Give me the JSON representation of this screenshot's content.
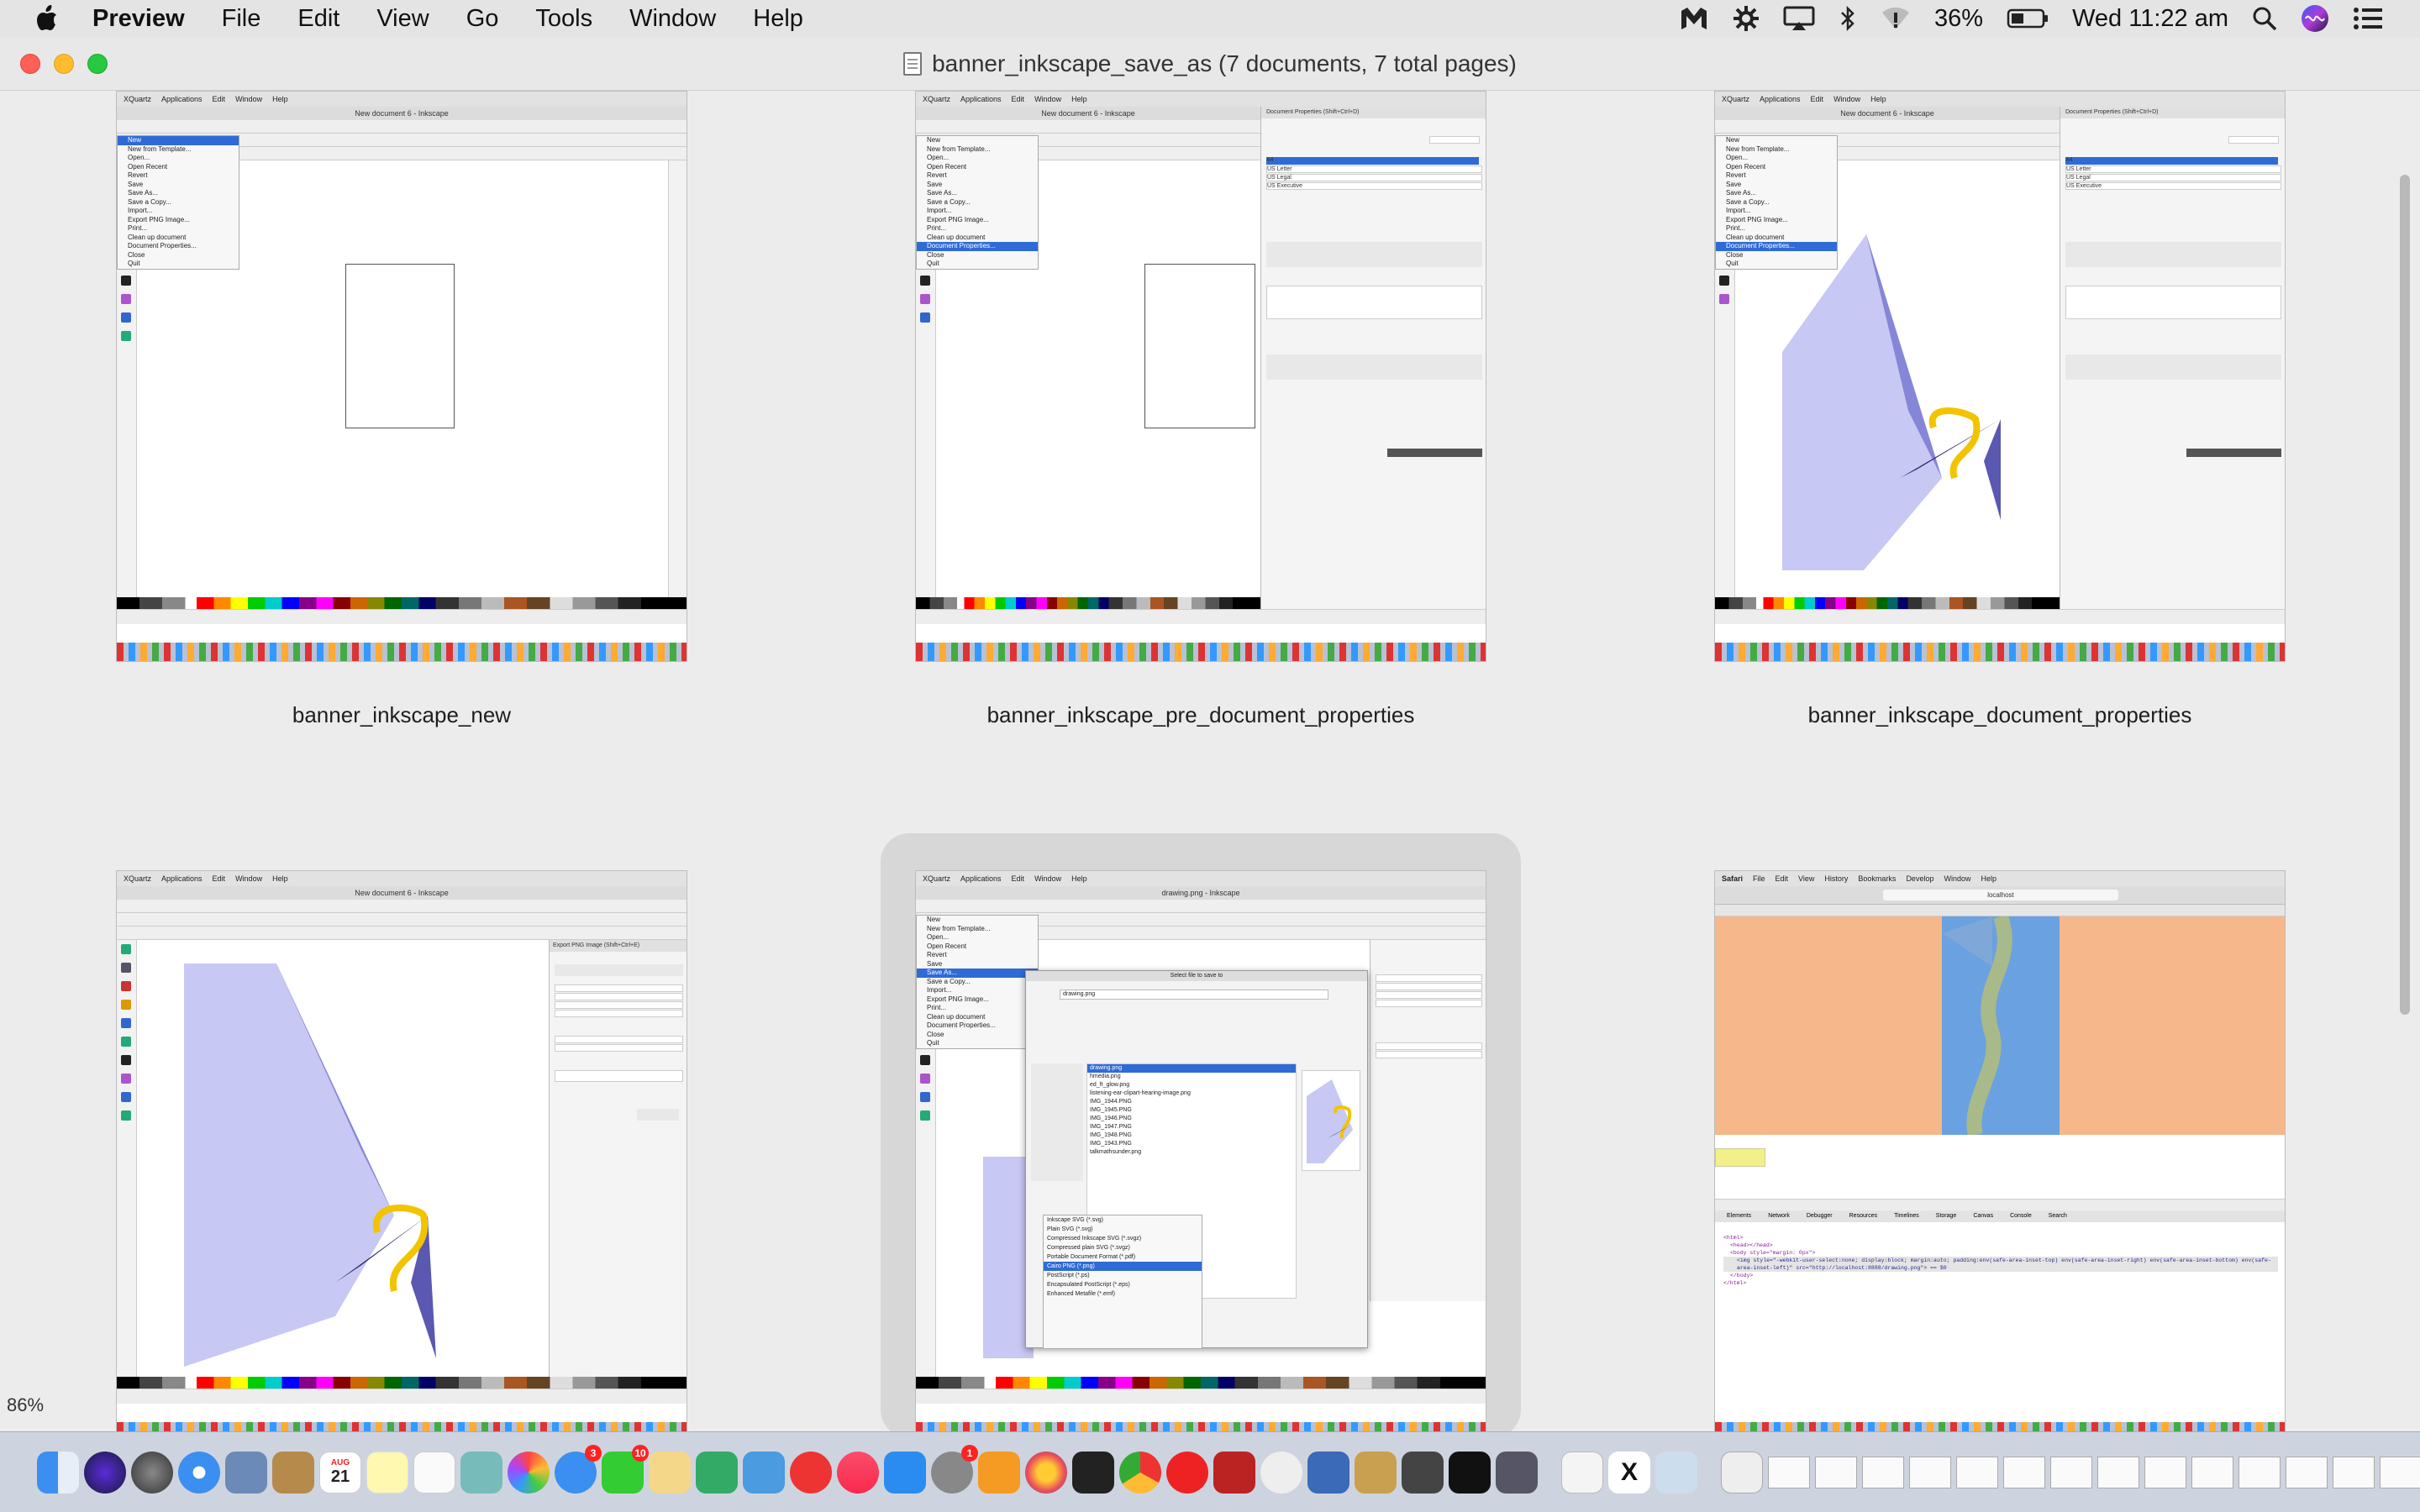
{
  "menubar": {
    "app_name": "Preview",
    "items": [
      "File",
      "Edit",
      "View",
      "Go",
      "Tools",
      "Window",
      "Help"
    ],
    "battery": "36%",
    "clock": "Wed 11:22 am"
  },
  "window": {
    "title": "banner_inkscape_save_as (7 documents, 7 total pages)"
  },
  "thumbnails": [
    {
      "label": "banner_inkscape_new"
    },
    {
      "label": "banner_inkscape_pre_document_properties"
    },
    {
      "label": "banner_inkscape_document_properties"
    },
    {
      "label": ""
    },
    {
      "label": ""
    },
    {
      "label": ""
    }
  ],
  "mini": {
    "xquartz_menu": [
      "XQuartz",
      "Applications",
      "Edit",
      "Window",
      "Help"
    ],
    "inkscape_title_new": "New document 6 - Inkscape",
    "inkscape_title_drawing": "drawing.png - Inkscape",
    "file_menu": [
      "New",
      "New from Template...",
      "Open...",
      "Open Recent",
      "Revert",
      "Save",
      "Save As...",
      "Save a Copy...",
      "Import...",
      "Export PNG Image...",
      "Print...",
      "Clean up document",
      "Document Properties...",
      "Close",
      "Quit"
    ],
    "doc_props_title": "Document Properties (Shift+Ctrl+D)",
    "paper_sizes": [
      "A4",
      "US Letter",
      "US Legal",
      "US Executive"
    ],
    "export_title": "Export PNG Image (Shift+Ctrl+E)",
    "save_dialog_title": "Select file to save to",
    "save_filename": "drawing.png",
    "save_files": [
      "drawing.png",
      "hmedia.png",
      "ed_ft_glow.png",
      "listening-ear-clipart-hearing-image.png",
      "IMG_1944.PNG",
      "IMG_1945.PNG",
      "IMG_1946.PNG",
      "IMG_1947.PNG",
      "IMG_1948.PNG",
      "IMG_1943.PNG",
      "talkmathsunder.png"
    ],
    "save_types": [
      "Inkscape SVG (*.svg)",
      "Plain SVG (*.svg)",
      "Compressed Inkscape SVG (*.svgz)",
      "Compressed plain SVG (*.svgz)",
      "Portable Document Format (*.pdf)",
      "Cairo PNG (*.png)",
      "PostScript (*.ps)",
      "Encapsulated PostScript (*.eps)",
      "Enhanced Metafile (*.emf)"
    ],
    "safari_menu": [
      "Safari",
      "File",
      "Edit",
      "View",
      "History",
      "Bookmarks",
      "Develop",
      "Window",
      "Help"
    ],
    "safari_url": "localhost",
    "devtools_tabs": [
      "Elements",
      "Network",
      "Debugger",
      "Resources",
      "Timelines",
      "Storage",
      "Canvas",
      "Console",
      "Search"
    ],
    "devtools_code": [
      "<html>",
      "<head></head>",
      "<body style=\"margin: 0px\">",
      "<img style=\"-webkit-user-select:none; display:block; margin:auto; padding:env(safe-area-inset-top) env(safe-area-inset-right) env(safe-area-inset-bottom) env(safe-area-inset-left)\" src=\"http://localhost:8888/drawing.png\"> == $0",
      "</body>",
      "</html>"
    ]
  },
  "zoom_indicator": "86%",
  "dock": {
    "calendar_month": "AUG",
    "calendar_day": "21",
    "badges": [
      "3",
      "10",
      "1"
    ]
  },
  "colors": {
    "menubar_bg": "#e4e4e4",
    "window_bg": "#ececec",
    "selection_blue": "#2f6bd6",
    "drawing_lavender": "#c8c8f4",
    "drawing_navy": "#2a2870",
    "drawing_yellow": "#f2c400",
    "safari_orange": "#f6b88a",
    "safari_blue": "#6aa1e0"
  }
}
